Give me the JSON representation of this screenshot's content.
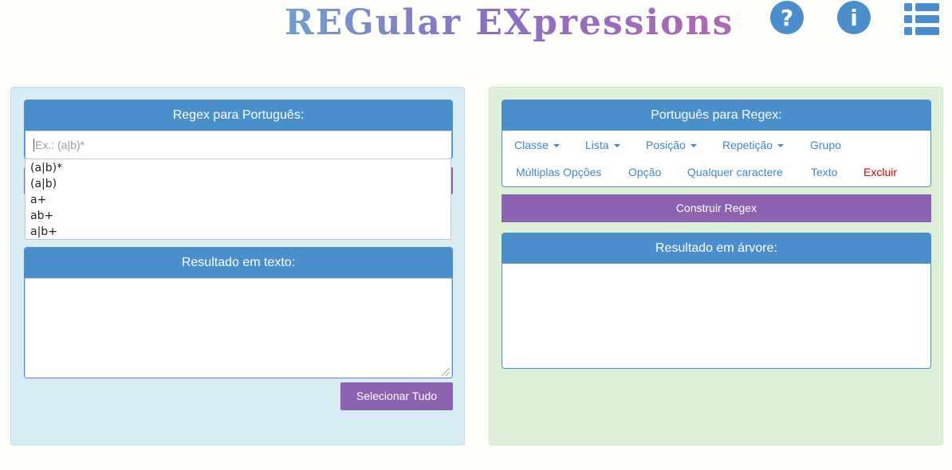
{
  "header": {
    "logo_text": "REGular EXpressions",
    "help_icon": "?",
    "info_icon": "i"
  },
  "left": {
    "regex_title": "Regex para Português:",
    "regex_placeholder": "Ex.: (a|b)*",
    "suggestions": [
      "(a|b)*",
      "(a|b)",
      "a+",
      "ab+",
      "a|b+"
    ],
    "text_result_title": "Resultado em texto:",
    "select_all_label": "Selecionar Tudo"
  },
  "right": {
    "p2r_title": "Português para Regex:",
    "nav_row1": {
      "classe": "Classe",
      "lista": "Lista",
      "posicao": "Posição",
      "repeticao": "Repetição",
      "grupo": "Grupo"
    },
    "nav_row2": {
      "multiplas": "Múltiplas Opções",
      "opcao": "Opção",
      "qualquer": "Qualquer caractere",
      "texto": "Texto",
      "excluir": "Excluir"
    },
    "build_label": "Construir Regex",
    "tree_title": "Resultado em árvore:"
  },
  "colors": {
    "primary": "#4a8fcb",
    "purple": "#8c63b0",
    "left_bg": "#d8ecf3",
    "right_bg": "#dff0d8",
    "danger": "#cc0000"
  }
}
